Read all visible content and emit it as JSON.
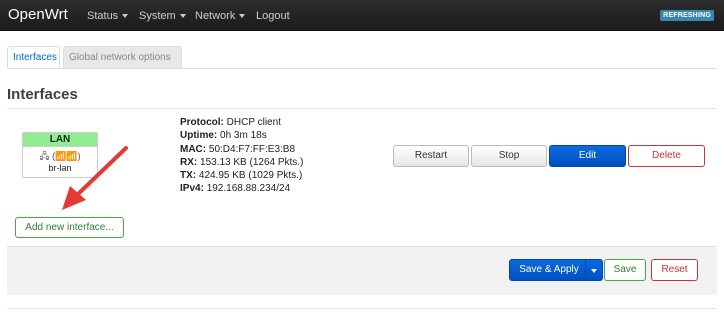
{
  "navbar": {
    "brand": "OpenWrt",
    "menu": [
      {
        "label": "Status",
        "dropdown": true
      },
      {
        "label": "System",
        "dropdown": true
      },
      {
        "label": "Network",
        "dropdown": true
      },
      {
        "label": "Logout",
        "dropdown": false
      }
    ],
    "status_badge": "REFRESHING"
  },
  "tabs": [
    {
      "label": "Interfaces",
      "active": true
    },
    {
      "label": "Global network options",
      "active": false
    }
  ],
  "page_title": "Interfaces",
  "interface": {
    "name": "LAN",
    "device": "br-lan",
    "icons": [
      "network-bridge-icon",
      "network-port-icon",
      "wireless-icon"
    ],
    "header_color": "#90ee90",
    "details": [
      {
        "key": "Protocol:",
        "value": "DHCP client"
      },
      {
        "key": "Uptime:",
        "value": "0h 3m 18s"
      },
      {
        "key": "MAC:",
        "value": "50:D4:F7:FF:E3:B8"
      },
      {
        "key": "RX:",
        "value": "153.13 KB (1264 Pkts.)"
      },
      {
        "key": "TX:",
        "value": "424.95 KB (1029 Pkts.)"
      },
      {
        "key": "IPv4:",
        "value": "192.168.88.234/24"
      }
    ],
    "buttons": {
      "restart": "Restart",
      "stop": "Stop",
      "edit": "Edit",
      "delete": "Delete"
    }
  },
  "add_interface_button": "Add new interface...",
  "actions": {
    "save_apply": "Save & Apply",
    "save": "Save",
    "reset": "Reset"
  },
  "colors": {
    "primary": "#0a6be0",
    "danger": "#cc3333",
    "success": "#44aa44",
    "annotation_arrow": "#e53935"
  }
}
